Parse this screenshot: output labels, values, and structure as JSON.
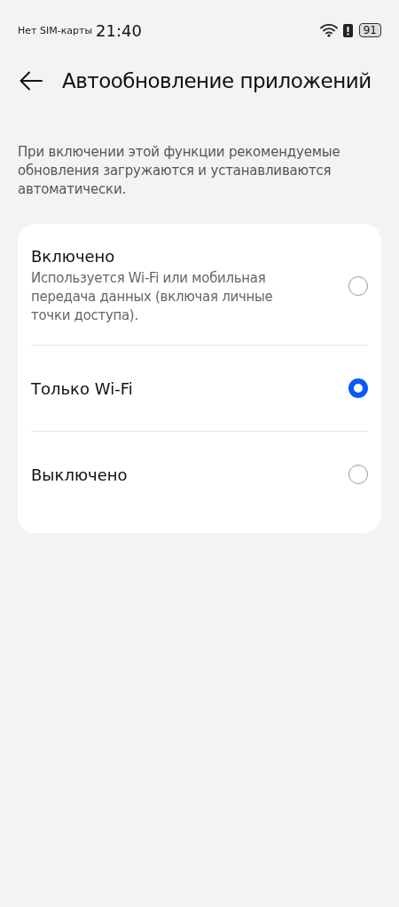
{
  "status_bar": {
    "carrier": "Нет SIM-карты",
    "time": "21:40",
    "battery": "91"
  },
  "header": {
    "title": "Автообновление приложений"
  },
  "description": "При включении этой функции рекомендуемые обновления загружаются и устанавливаются автоматически.",
  "options": [
    {
      "label": "Включено",
      "description": "Используется Wi-Fi или мобильная передача данных (включая личные точки доступа).",
      "selected": false
    },
    {
      "label": "Только Wi-Fi",
      "selected": true
    },
    {
      "label": "Выключено",
      "selected": false
    }
  ]
}
